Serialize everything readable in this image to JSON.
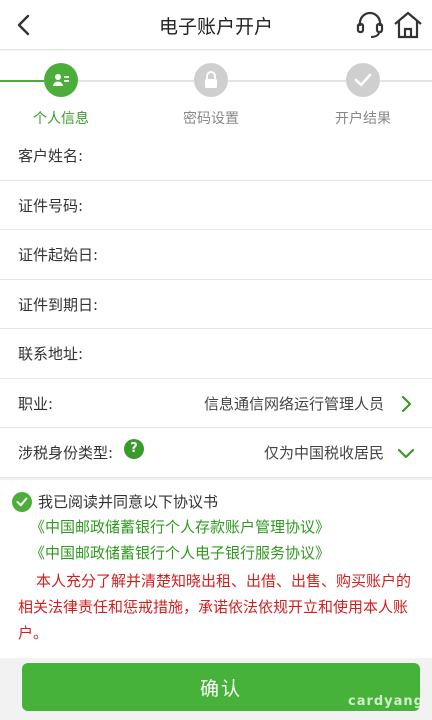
{
  "header": {
    "title": "电子账户开户"
  },
  "steps": [
    {
      "label": "个人信息",
      "state": "active",
      "icon": "person-card-icon"
    },
    {
      "label": "密码设置",
      "state": "inactive",
      "icon": "lock-icon"
    },
    {
      "label": "开户结果",
      "state": "inactive",
      "icon": "check-icon"
    }
  ],
  "form": {
    "name_label": "客户姓名:",
    "id_number_label": "证件号码:",
    "id_start_label": "证件起始日:",
    "id_end_label": "证件到期日:",
    "address_label": "联系地址:",
    "occupation_label": "职业:",
    "occupation_value": "信息通信网络运行管理人员",
    "tax_label": "涉税身份类型:",
    "tax_value": "仅为中国税收居民",
    "help_symbol": "?"
  },
  "agreement": {
    "ack_text": "我已阅读并同意以下协议书",
    "link1": "《中国邮政储蓄银行个人存款账户管理协议》",
    "link2": "《中国邮政储蓄银行个人电子银行服务协议》",
    "warning": "本人充分了解并清楚知晓出租、出借、出售、购买账户的相关法律责任和惩戒措施，承诺依法依规开立和使用本人账户。"
  },
  "confirm_label": "确认",
  "watermark": "cardyang",
  "colors": {
    "accent": "#4cae3a",
    "warning": "#d21f1f",
    "link": "#2f9a1f"
  }
}
